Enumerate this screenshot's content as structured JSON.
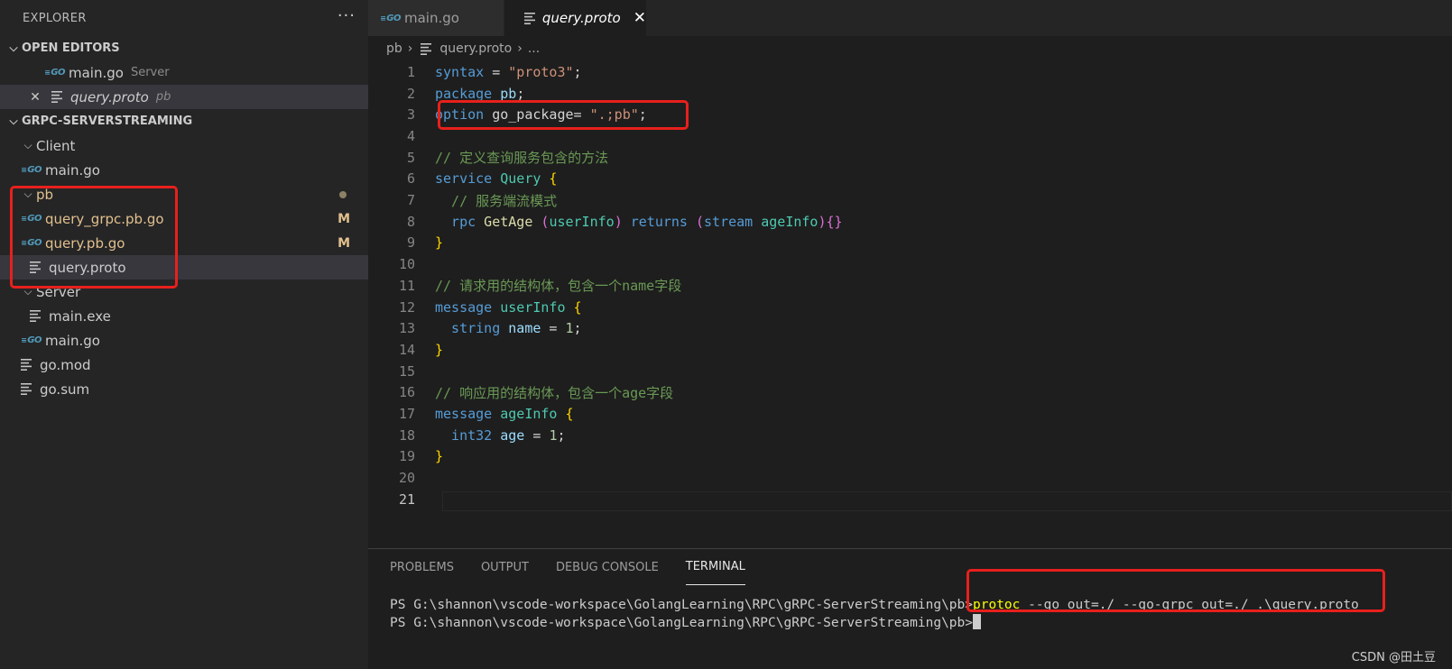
{
  "explorer": {
    "title": "EXPLORER",
    "more": "···",
    "open_editors_label": "OPEN EDITORS",
    "open_editors": [
      {
        "name": "main.go",
        "desc": "Server"
      },
      {
        "name": "query.proto",
        "desc": "pb"
      }
    ],
    "project_label": "GRPC-SERVERSTREAMING",
    "tree": {
      "client": "Client",
      "client_main": "main.go",
      "pb": "pb",
      "grpc_go": "query_grpc.pb.go",
      "pb_go": "query.pb.go",
      "proto": "query.proto",
      "modified_badge": "M",
      "server": "Server",
      "server_exe": "main.exe",
      "server_main": "main.go",
      "gomod": "go.mod",
      "gosum": "go.sum"
    }
  },
  "tabs": [
    {
      "label": "main.go"
    },
    {
      "label": "query.proto"
    }
  ],
  "breadcrumb": {
    "folder": "pb",
    "file": "query.proto",
    "more": "..."
  },
  "code": {
    "lines": [
      "1",
      "2",
      "3",
      "4",
      "5",
      "6",
      "7",
      "8",
      "9",
      "10",
      "11",
      "12",
      "13",
      "14",
      "15",
      "16",
      "17",
      "18",
      "19",
      "20",
      "21"
    ],
    "l1_kw": "syntax",
    "l1_eq": " = ",
    "l1_str": "\"proto3\"",
    "l1_end": ";",
    "l2_kw": "package",
    "l2_name": " pb",
    "l2_end": ";",
    "l3_kw": "option",
    "l3_name": " go_package",
    "l3_eq": "= ",
    "l3_str": "\".;pb\"",
    "l3_end": ";",
    "l5_cmt": "// 定义查询服务包含的方法",
    "l6_kw": "service",
    "l6_ty": " Query",
    "l6_br": " {",
    "l7_cmt": "  // 服务端流模式",
    "l8_kw": "  rpc",
    "l8_fn": " GetAge",
    "l8_p1": " (",
    "l8_t1": "userInfo",
    "l8_p2": ")",
    "l8_ret": " returns",
    "l8_p3": " (",
    "l8_stream": "stream",
    "l8_t2": " ageInfo",
    "l8_p4": ")",
    "l8_br": "{}",
    "l9_br": "}",
    "l11_cmt": "// 请求用的结构体，包含一个name字段",
    "l12_kw": "message",
    "l12_ty": " userInfo",
    "l12_br": " {",
    "l13_ty": "  string",
    "l13_var": " name",
    "l13_eq": " = ",
    "l13_num": "1",
    "l13_end": ";",
    "l14_br": "}",
    "l16_cmt": "// 响应用的结构体，包含一个age字段",
    "l17_kw": "message",
    "l17_ty": " ageInfo",
    "l17_br": " {",
    "l18_ty": "  int32",
    "l18_var": " age",
    "l18_eq": " = ",
    "l18_num": "1",
    "l18_end": ";",
    "l19_br": "}"
  },
  "panel": {
    "tabs": [
      "PROBLEMS",
      "OUTPUT",
      "DEBUG CONSOLE",
      "TERMINAL"
    ],
    "prompt": "PS G:\\shannon\\vscode-workspace\\GolangLearning\\RPC\\gRPC-ServerStreaming\\pb>",
    "cmd": "protoc",
    "args": " --go_out=./ --go-grpc_out=./ .\\query.proto"
  },
  "watermark": "CSDN @田土豆",
  "colors": {
    "accent_red": "#e8201c",
    "modified": "#e2c08d",
    "go_icon": "#519aba"
  }
}
